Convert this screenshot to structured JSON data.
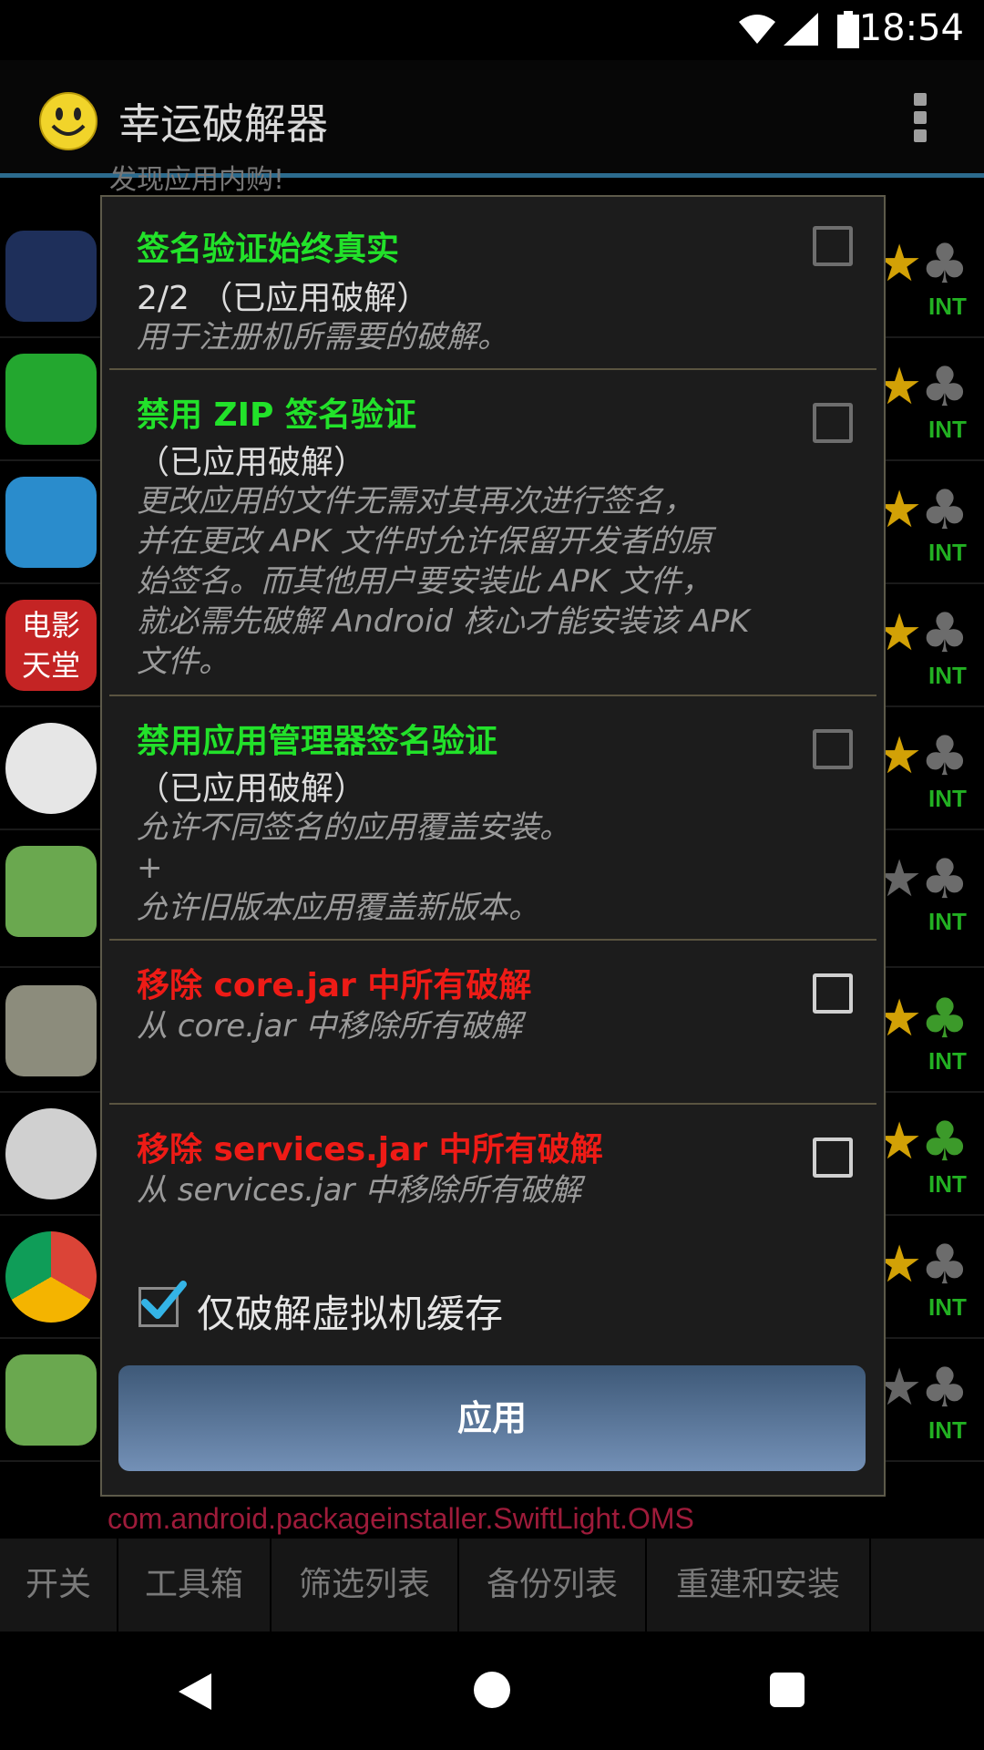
{
  "status_bar": {
    "time": "18:54"
  },
  "app_bar": {
    "title": "幸运破解器"
  },
  "background": {
    "peek_text": "发现应用内购!",
    "rows": [
      {
        "label": "INT",
        "clover": "grey",
        "star": "gold"
      },
      {
        "label": "INT",
        "clover": "grey",
        "star": "gold"
      },
      {
        "label": "INT",
        "clover": "grey",
        "star": "gold"
      },
      {
        "label": "INT",
        "clover": "grey",
        "star": "gold"
      },
      {
        "label": "INT",
        "clover": "grey",
        "star": "gold"
      },
      {
        "label": "INT",
        "clover": "grey",
        "star": "grey"
      },
      {
        "label": "INT",
        "clover": "green",
        "star": "gold"
      },
      {
        "label": "INT",
        "clover": "green",
        "star": "gold"
      },
      {
        "label": "INT",
        "clover": "grey",
        "star": "gold"
      },
      {
        "label": "INT",
        "clover": "grey",
        "star": "grey"
      }
    ],
    "movie_icon_text": "电影天堂",
    "package_text": "com.android.packageinstaller.SwiftLight.OMS"
  },
  "tabs": [
    "开关",
    "工具箱",
    "筛选列表",
    "备份列表",
    "重建和安装"
  ],
  "dialog": {
    "items": [
      {
        "title": "签名验证始终真实",
        "color": "green",
        "status": "2/2 （已应用破解）",
        "desc": "用于注册机所需要的破解。",
        "checked": false
      },
      {
        "title": "禁用 ZIP 签名验证",
        "color": "green",
        "status": "（已应用破解）",
        "desc": "更改应用的文件无需对其再次进行签名，\n并在更改 APK 文件时允许保留开发者的原\n始签名。而其他用户要安装此 APK 文件，\n就必需先破解 Android 核心才能安装该 APK\n文件。",
        "checked": false
      },
      {
        "title": "禁用应用管理器签名验证",
        "color": "green",
        "status": "（已应用破解）",
        "desc": "允许不同签名的应用覆盖安装。\n+\n允许旧版本应用覆盖新版本。",
        "checked": false
      },
      {
        "title": "移除 core.jar 中所有破解",
        "color": "red",
        "status": "",
        "desc": "从 core.jar 中移除所有破解",
        "checked": false
      },
      {
        "title": "移除 services.jar 中所有破解",
        "color": "red",
        "status": "",
        "desc": "从 services.jar 中移除所有破解",
        "checked": false
      }
    ],
    "vm_cache_label": "仅破解虚拟机缓存",
    "vm_cache_checked": true,
    "apply_label": "应用"
  },
  "colors": {
    "accent_green": "#22e22a",
    "accent_red": "#ee1b16",
    "app_bar_line": "#2c6b8e",
    "apply_button": "#5b7699"
  }
}
